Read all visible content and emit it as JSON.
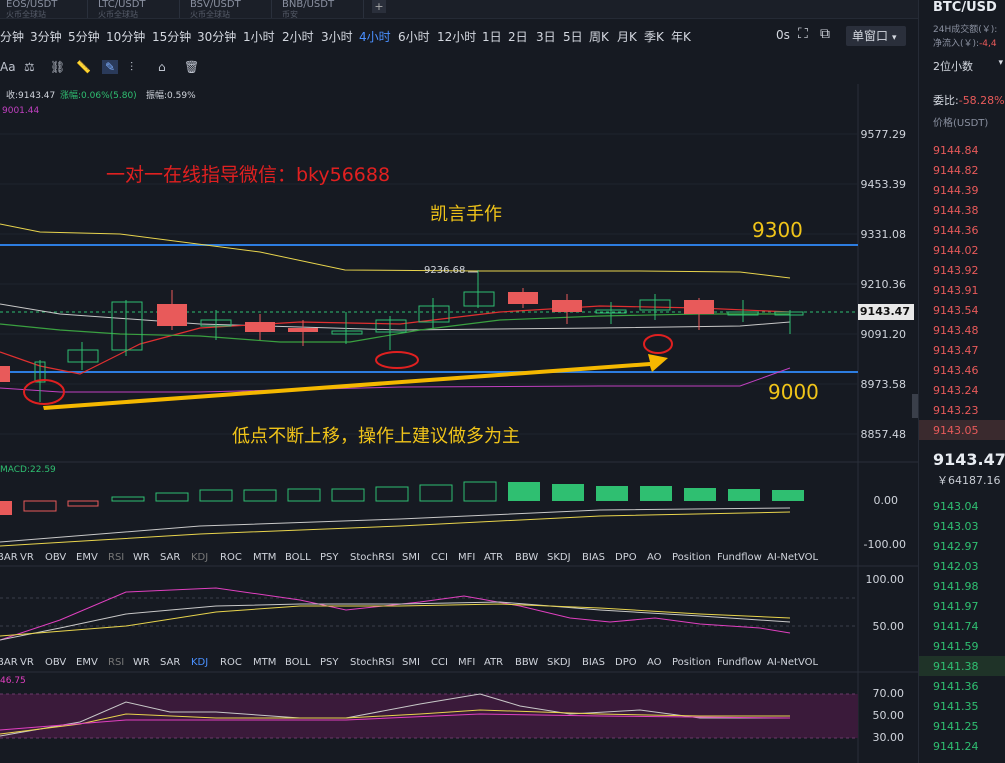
{
  "tabs": [
    {
      "pair": "EOS/USDT",
      "sub": "火币全球站"
    },
    {
      "pair": "LTC/USDT",
      "sub": "火币全球站"
    },
    {
      "pair": "BSV/USDT",
      "sub": "火币全球站"
    },
    {
      "pair": "BNB/USDT",
      "sub": "币安"
    }
  ],
  "add_tab": "+",
  "timeframes": [
    "分钟",
    "3分钟",
    "5分钟",
    "10分钟",
    "15分钟",
    "30分钟",
    "1小时",
    "2小时",
    "3小时",
    "4小时",
    "6小时",
    "12小时",
    "1日",
    "2日",
    "3日",
    "5日",
    "周K",
    "月K",
    "季K",
    "年K"
  ],
  "active_timeframe": "4小时",
  "countdown": "0s",
  "window_select": "单窗口",
  "draw_tools": {
    "text": "Aa"
  },
  "ohlc_line": {
    "close": "收:9143.47",
    "change": "涨幅:0.06%(5.80)",
    "amp": "振幅:0.59%"
  },
  "ma_value": "9001.44",
  "price_axis": [
    "9577.29",
    "9453.39",
    "9331.08",
    "9210.36",
    "9091.20",
    "8973.58",
    "8857.48"
  ],
  "current_price": "9143.47",
  "annotations": {
    "wechat": "一对一在线指导微信：bky56688",
    "author": "凯言手作",
    "level_high": "9300",
    "level_low": "9000",
    "peak_label": "9236.68",
    "comment": "低点不断上移，操作上建议做多为主"
  },
  "macd": {
    "label": "MACD:22.59",
    "axis": [
      "0.00",
      "-100.00"
    ]
  },
  "indicator_tabs": [
    "BAR",
    "VR",
    "OBV",
    "EMV",
    "RSI",
    "WR",
    "SAR",
    "KDJ",
    "ROC",
    "MTM",
    "BOLL",
    "PSY",
    "StochRSI",
    "SMI",
    "CCI",
    "MFI",
    "ATR",
    "BBW",
    "SKDJ",
    "BIAS",
    "DPO",
    "AO",
    "Position",
    "Fundflow",
    "AI-NetVOL"
  ],
  "kdj": {
    "axis": [
      "100.00",
      "50.00"
    ]
  },
  "rsi": {
    "label": "46.75",
    "axis": [
      "70.00",
      "50.00",
      "30.00"
    ]
  },
  "right": {
    "pair": "BTC/USD",
    "volume_label": "24H成交额(￥):",
    "inflow_label": "净流入(￥):",
    "inflow_value": "-4,4",
    "decimals": "2位小数",
    "ratio_label": "委比:",
    "ratio_value": "-58.28%",
    "price_header": "价格(USDT)",
    "asks": [
      "9144.84",
      "9144.82",
      "9144.39",
      "9144.38",
      "9144.36",
      "9144.02",
      "9143.92",
      "9143.91",
      "9143.54",
      "9143.48",
      "9143.47",
      "9143.46",
      "9143.24",
      "9143.23",
      "9143.05"
    ],
    "last_price": "9143.47",
    "last_cny": "￥64187.16",
    "bids": [
      "9143.04",
      "9143.03",
      "9142.97",
      "9142.03",
      "9141.98",
      "9141.97",
      "9141.74",
      "9141.59",
      "9141.38",
      "9141.36",
      "9141.35",
      "9141.25",
      "9141.24"
    ]
  },
  "colors": {
    "up": "#2fbf71",
    "down": "#e85a5a",
    "accent": "#4a90ff",
    "annotation_red": "#e02020",
    "annotation_yellow": "#f0c419",
    "arrow": "#f5b800"
  }
}
